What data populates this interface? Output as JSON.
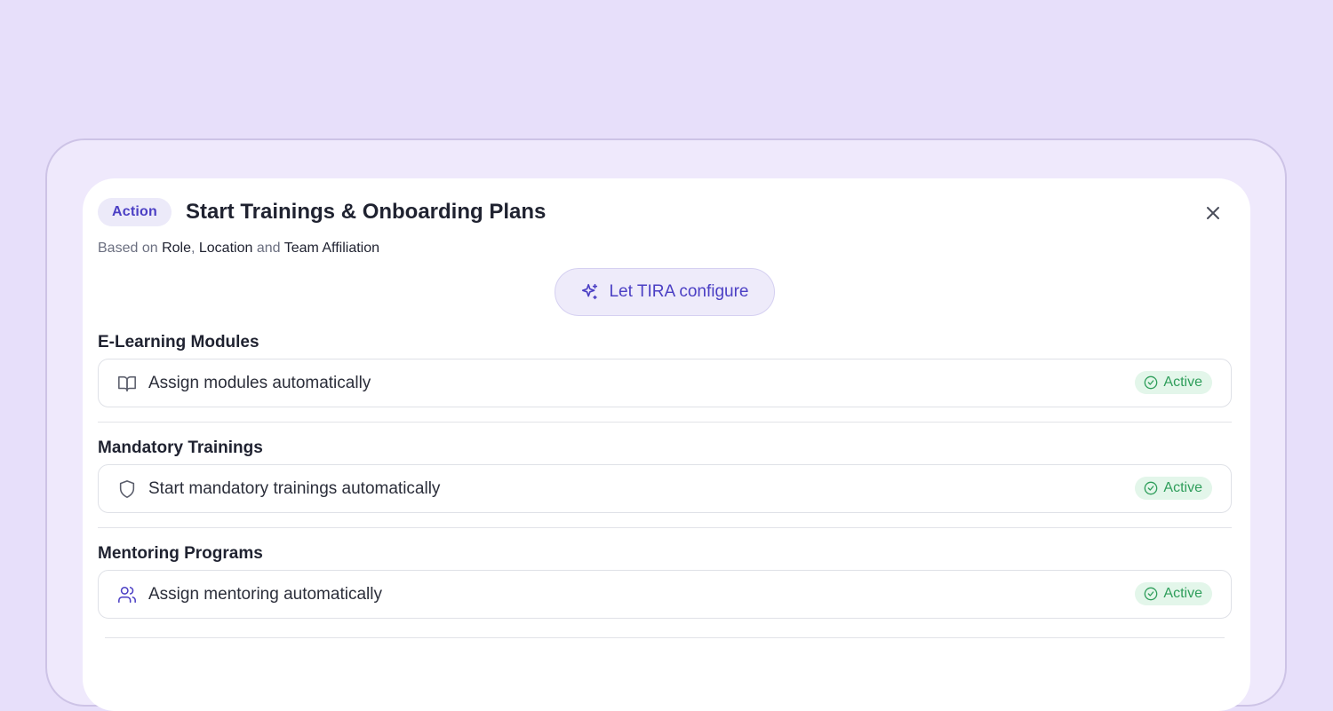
{
  "header": {
    "badge": "Action",
    "title": "Start Trainings & Onboarding Plans",
    "close_icon": "close-icon"
  },
  "subtitle": {
    "prefix": "Based on",
    "role": "Role",
    "comma": ",",
    "location": "Location",
    "and": "and",
    "team": "Team Affiliation"
  },
  "ai_button": {
    "label": "Let TIRA configure",
    "icon": "sparkles-icon"
  },
  "sections": [
    {
      "title": "E-Learning Modules",
      "row_label": "Assign modules automatically",
      "icon": "book-open-icon",
      "status": "Active"
    },
    {
      "title": "Mandatory Trainings",
      "row_label": "Start mandatory trainings automatically",
      "icon": "shield-icon",
      "status": "Active"
    },
    {
      "title": "Mentoring Programs",
      "row_label": "Assign mentoring automatically",
      "icon": "users-icon",
      "status": "Active"
    }
  ],
  "colors": {
    "background": "#e7dffa",
    "accent": "#4b3fc4",
    "active_green": "#2f9e5b",
    "active_bg": "#e3f6ea"
  }
}
